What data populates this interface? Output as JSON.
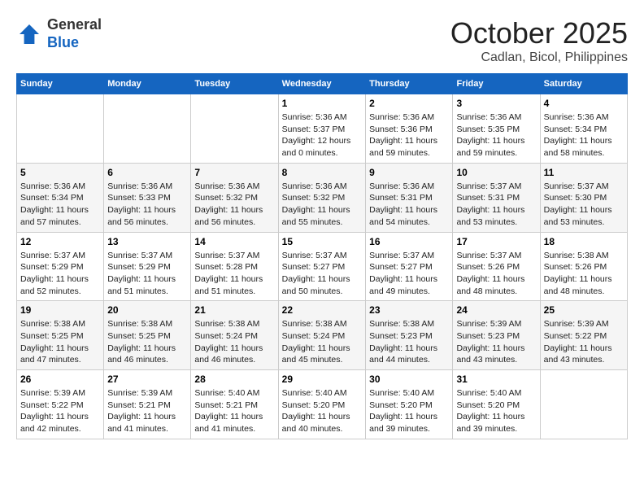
{
  "header": {
    "logo_line1": "General",
    "logo_line2": "Blue",
    "month": "October 2025",
    "location": "Cadlan, Bicol, Philippines"
  },
  "weekdays": [
    "Sunday",
    "Monday",
    "Tuesday",
    "Wednesday",
    "Thursday",
    "Friday",
    "Saturday"
  ],
  "weeks": [
    [
      {
        "day": "",
        "text": ""
      },
      {
        "day": "",
        "text": ""
      },
      {
        "day": "",
        "text": ""
      },
      {
        "day": "1",
        "text": "Sunrise: 5:36 AM\nSunset: 5:37 PM\nDaylight: 12 hours and 0 minutes."
      },
      {
        "day": "2",
        "text": "Sunrise: 5:36 AM\nSunset: 5:36 PM\nDaylight: 11 hours and 59 minutes."
      },
      {
        "day": "3",
        "text": "Sunrise: 5:36 AM\nSunset: 5:35 PM\nDaylight: 11 hours and 59 minutes."
      },
      {
        "day": "4",
        "text": "Sunrise: 5:36 AM\nSunset: 5:34 PM\nDaylight: 11 hours and 58 minutes."
      }
    ],
    [
      {
        "day": "5",
        "text": "Sunrise: 5:36 AM\nSunset: 5:34 PM\nDaylight: 11 hours and 57 minutes."
      },
      {
        "day": "6",
        "text": "Sunrise: 5:36 AM\nSunset: 5:33 PM\nDaylight: 11 hours and 56 minutes."
      },
      {
        "day": "7",
        "text": "Sunrise: 5:36 AM\nSunset: 5:32 PM\nDaylight: 11 hours and 56 minutes."
      },
      {
        "day": "8",
        "text": "Sunrise: 5:36 AM\nSunset: 5:32 PM\nDaylight: 11 hours and 55 minutes."
      },
      {
        "day": "9",
        "text": "Sunrise: 5:36 AM\nSunset: 5:31 PM\nDaylight: 11 hours and 54 minutes."
      },
      {
        "day": "10",
        "text": "Sunrise: 5:37 AM\nSunset: 5:31 PM\nDaylight: 11 hours and 53 minutes."
      },
      {
        "day": "11",
        "text": "Sunrise: 5:37 AM\nSunset: 5:30 PM\nDaylight: 11 hours and 53 minutes."
      }
    ],
    [
      {
        "day": "12",
        "text": "Sunrise: 5:37 AM\nSunset: 5:29 PM\nDaylight: 11 hours and 52 minutes."
      },
      {
        "day": "13",
        "text": "Sunrise: 5:37 AM\nSunset: 5:29 PM\nDaylight: 11 hours and 51 minutes."
      },
      {
        "day": "14",
        "text": "Sunrise: 5:37 AM\nSunset: 5:28 PM\nDaylight: 11 hours and 51 minutes."
      },
      {
        "day": "15",
        "text": "Sunrise: 5:37 AM\nSunset: 5:27 PM\nDaylight: 11 hours and 50 minutes."
      },
      {
        "day": "16",
        "text": "Sunrise: 5:37 AM\nSunset: 5:27 PM\nDaylight: 11 hours and 49 minutes."
      },
      {
        "day": "17",
        "text": "Sunrise: 5:37 AM\nSunset: 5:26 PM\nDaylight: 11 hours and 48 minutes."
      },
      {
        "day": "18",
        "text": "Sunrise: 5:38 AM\nSunset: 5:26 PM\nDaylight: 11 hours and 48 minutes."
      }
    ],
    [
      {
        "day": "19",
        "text": "Sunrise: 5:38 AM\nSunset: 5:25 PM\nDaylight: 11 hours and 47 minutes."
      },
      {
        "day": "20",
        "text": "Sunrise: 5:38 AM\nSunset: 5:25 PM\nDaylight: 11 hours and 46 minutes."
      },
      {
        "day": "21",
        "text": "Sunrise: 5:38 AM\nSunset: 5:24 PM\nDaylight: 11 hours and 46 minutes."
      },
      {
        "day": "22",
        "text": "Sunrise: 5:38 AM\nSunset: 5:24 PM\nDaylight: 11 hours and 45 minutes."
      },
      {
        "day": "23",
        "text": "Sunrise: 5:38 AM\nSunset: 5:23 PM\nDaylight: 11 hours and 44 minutes."
      },
      {
        "day": "24",
        "text": "Sunrise: 5:39 AM\nSunset: 5:23 PM\nDaylight: 11 hours and 43 minutes."
      },
      {
        "day": "25",
        "text": "Sunrise: 5:39 AM\nSunset: 5:22 PM\nDaylight: 11 hours and 43 minutes."
      }
    ],
    [
      {
        "day": "26",
        "text": "Sunrise: 5:39 AM\nSunset: 5:22 PM\nDaylight: 11 hours and 42 minutes."
      },
      {
        "day": "27",
        "text": "Sunrise: 5:39 AM\nSunset: 5:21 PM\nDaylight: 11 hours and 41 minutes."
      },
      {
        "day": "28",
        "text": "Sunrise: 5:40 AM\nSunset: 5:21 PM\nDaylight: 11 hours and 41 minutes."
      },
      {
        "day": "29",
        "text": "Sunrise: 5:40 AM\nSunset: 5:20 PM\nDaylight: 11 hours and 40 minutes."
      },
      {
        "day": "30",
        "text": "Sunrise: 5:40 AM\nSunset: 5:20 PM\nDaylight: 11 hours and 39 minutes."
      },
      {
        "day": "31",
        "text": "Sunrise: 5:40 AM\nSunset: 5:20 PM\nDaylight: 11 hours and 39 minutes."
      },
      {
        "day": "",
        "text": ""
      }
    ]
  ]
}
